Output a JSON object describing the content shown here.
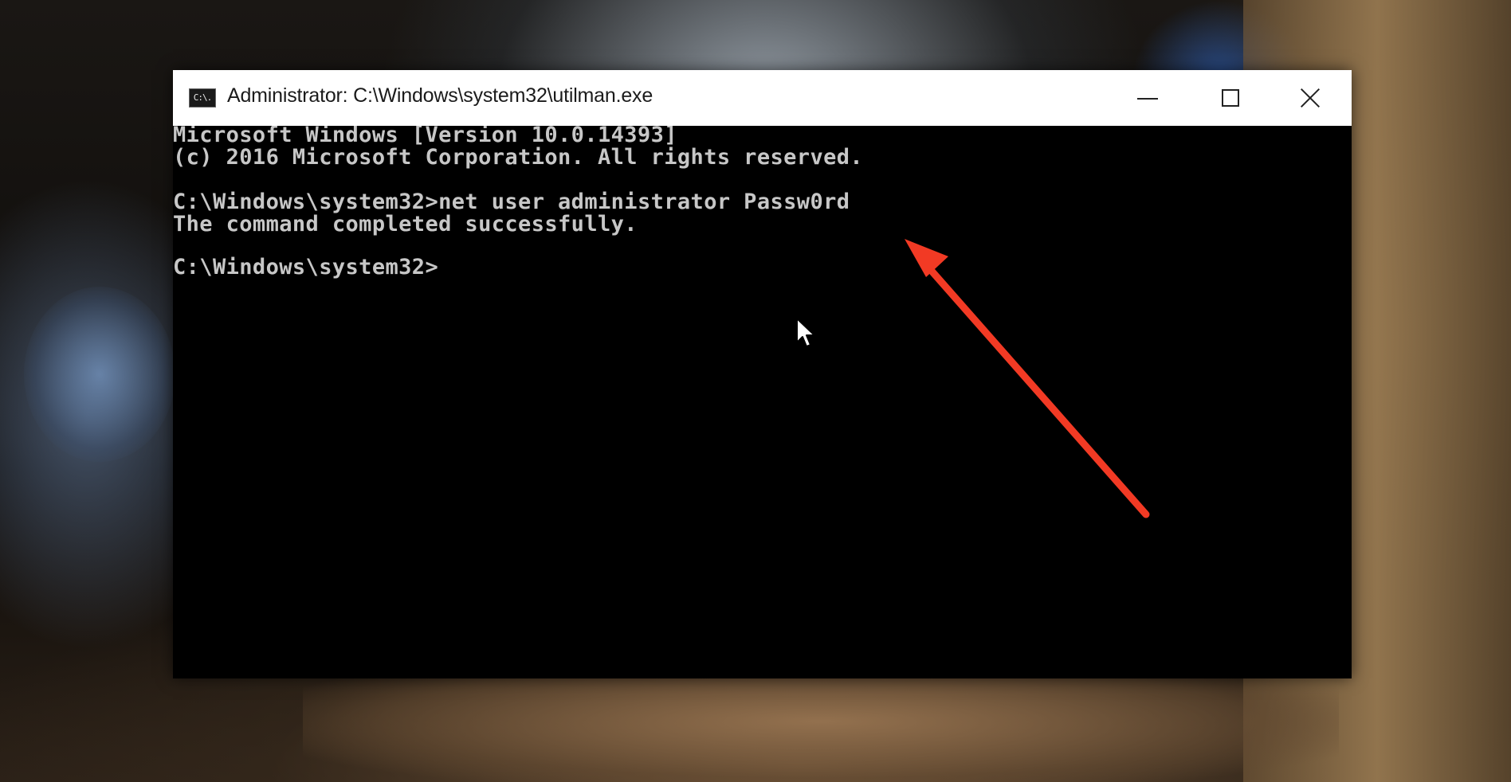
{
  "window": {
    "title": "Administrator: C:\\Windows\\system32\\utilman.exe",
    "icon_name": "cmd-icon",
    "icon_text": "C:\\.",
    "controls": [
      "minimize-icon",
      "maximize-icon",
      "close-icon"
    ]
  },
  "console": {
    "lines": [
      "Microsoft Windows [Version 10.0.14393]",
      "(c) 2016 Microsoft Corporation. All rights reserved.",
      "C:\\Windows\\system32>net user administrator Passw0rd",
      "The command completed successfully.",
      "C:\\Windows\\system32>"
    ],
    "text_color": "#c7c7c7",
    "background": "#000000"
  },
  "annotation": {
    "type": "arrow",
    "color": "#f23a24",
    "points_to": "Passw0rd"
  },
  "pointer": "mouse-cursor-icon"
}
